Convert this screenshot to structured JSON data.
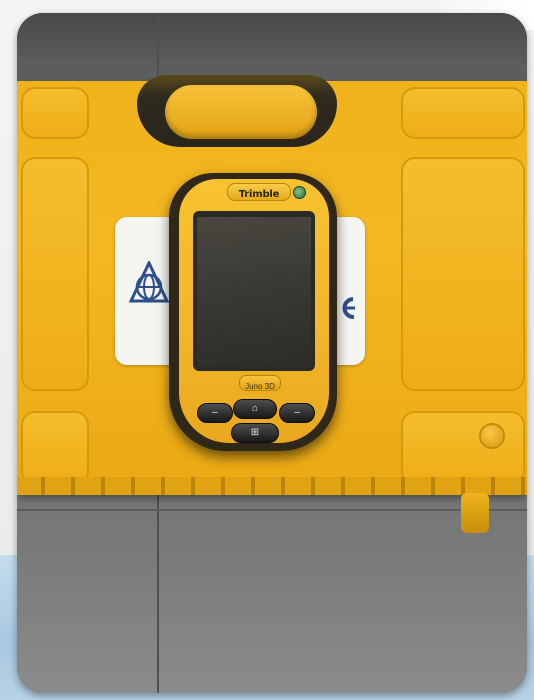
{
  "photo": {
    "device": {
      "brand": "Trimble",
      "model": "Juno 3D"
    },
    "icons": {
      "power": "power-led-icon",
      "home": "home-icon",
      "start": "windows-start-icon",
      "left_key": "left-softkey-icon",
      "right_key": "right-softkey-icon"
    },
    "colors": {
      "case": "#f0b21a",
      "device_body": "#f2b72a",
      "page_band": "#a9c8e1"
    }
  }
}
